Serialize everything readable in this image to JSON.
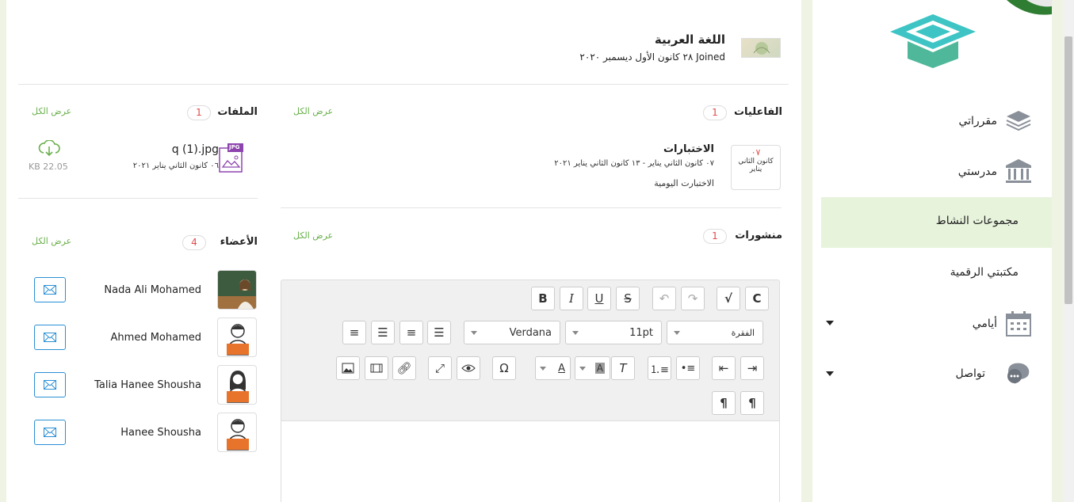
{
  "course": {
    "title": "اللغة العربية",
    "joined": "Joined ٢٨ كانون الأول ديسمبر ٢٠٢٠"
  },
  "activities": {
    "heading": "الفاعليات",
    "count": "1",
    "view_all": "عرض الكل",
    "item": {
      "badge_day": "٠٧",
      "badge_month": "كانون الثاني",
      "badge_month2": "يناير",
      "title": "الاختبارات",
      "date_range": "٠٧ كانون الثاني يناير - ١٣ كانون الثاني يناير ٢٠٢١",
      "subtitle": "الاختبارت اليومية"
    }
  },
  "files": {
    "heading": "الملفات",
    "count": "1",
    "view_all": "عرض الكل",
    "item": {
      "type_label": "JPG",
      "name": "q (1).jpg",
      "date": "٠٦ كانون الثاني يناير ٢٠٢١",
      "size": "KB 22.05"
    }
  },
  "posts": {
    "heading": "منشورات",
    "count": "1",
    "view_all": "عرض الكل"
  },
  "members": {
    "heading": "الأعضاء",
    "count": "4",
    "view_all": "عرض الكل",
    "list": [
      {
        "name": "Nada Ali Mohamed"
      },
      {
        "name": "Ahmed Mohamed"
      },
      {
        "name": "Talia Hanee Shousha"
      },
      {
        "name": "Hanee Shousha"
      }
    ]
  },
  "editor": {
    "bold": "B",
    "italic": "I",
    "underline": "U",
    "strike": "S",
    "font_family": "Verdana",
    "font_size": "11pt",
    "paragraph": "الفقرة",
    "omega": "Ω",
    "text_color_letter": "A",
    "bg_color_letter": "A",
    "clear_format_letter": "T",
    "ltr_mark": "¶",
    "rtl_mark": "¶"
  },
  "sidebar": {
    "items": [
      {
        "label": "مقرراتي",
        "icon": "layers-icon"
      },
      {
        "label": "مدرستي",
        "icon": "school-building-icon"
      },
      {
        "label": "مجموعات النشاط",
        "active": true
      },
      {
        "label": "مكتبتي الرقمية"
      },
      {
        "label": "أيامي",
        "icon": "calendar-icon"
      },
      {
        "label": "تواصل",
        "icon": "chat-icon"
      }
    ],
    "active_bg": "#e8f3dc"
  },
  "colors": {
    "accent_green": "#6ab04c",
    "count_red": "#e04b4b",
    "mail_blue": "#2a8fd4",
    "logo_teal": "#3ec4c4"
  }
}
